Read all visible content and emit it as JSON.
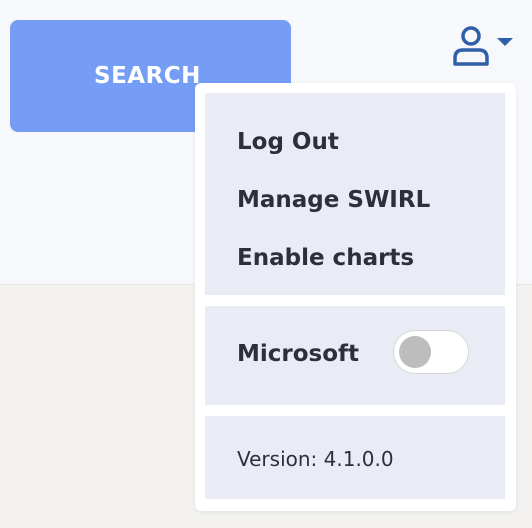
{
  "search_button": {
    "label": "SEARCH"
  },
  "user_menu": {
    "icon": "user-icon",
    "caret_icon": "caret-down-icon",
    "accent_color": "#2f5fa8",
    "links": [
      {
        "label": "Log Out"
      },
      {
        "label": "Manage SWIRL"
      },
      {
        "label": "Enable charts"
      }
    ],
    "toggle": {
      "label": "Microsoft",
      "enabled": false
    },
    "version_text": "Version: 4.1.0.0"
  },
  "colors": {
    "search_button_bg": "#759df5",
    "menu_section_bg": "#e9ecf4",
    "text": "#2d3039"
  }
}
